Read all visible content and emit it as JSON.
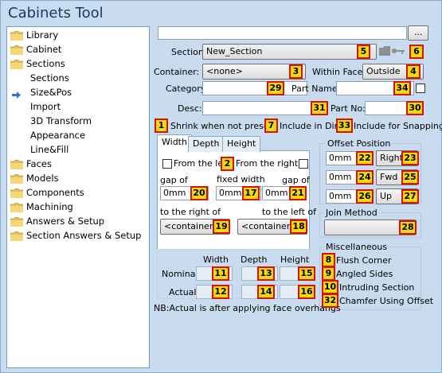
{
  "window": {
    "title": "Cabinets Tool"
  },
  "tree": {
    "items": [
      {
        "label": "Library",
        "level": 0,
        "folder": true
      },
      {
        "label": "Cabinet",
        "level": 0,
        "folder": true
      },
      {
        "label": "Sections",
        "level": 0,
        "folder": true
      },
      {
        "label": "Sections",
        "level": 1,
        "folder": false
      },
      {
        "label": "Size&Pos",
        "level": 1,
        "folder": false,
        "selected": true
      },
      {
        "label": "Import",
        "level": 1,
        "folder": false
      },
      {
        "label": "3D Transform",
        "level": 1,
        "folder": false
      },
      {
        "label": "Appearance",
        "level": 1,
        "folder": false
      },
      {
        "label": "Line&Fill",
        "level": 1,
        "folder": false
      },
      {
        "label": "Faces",
        "level": 0,
        "folder": true
      },
      {
        "label": "Models",
        "level": 0,
        "folder": true
      },
      {
        "label": "Components",
        "level": 0,
        "folder": true
      },
      {
        "label": "Machining",
        "level": 0,
        "folder": true
      },
      {
        "label": "Answers & Setup",
        "level": 0,
        "folder": true
      },
      {
        "label": "Section Answers & Setup",
        "level": 0,
        "folder": true
      }
    ]
  },
  "top": {
    "path_value": "",
    "browse_label": "..."
  },
  "section": {
    "label": "Section:",
    "value": "New_Section",
    "badge": "5",
    "badge2": "6"
  },
  "container": {
    "label": "Container:",
    "value": "<none>",
    "badge": "3"
  },
  "within_face": {
    "label": "Within Face:",
    "value": "Outside",
    "badge": "4"
  },
  "category": {
    "label": "Category:",
    "value": "",
    "badge": "29"
  },
  "part_name": {
    "label": "Part Name:",
    "value": "",
    "badge": "34"
  },
  "desc": {
    "label": "Desc:",
    "value": "",
    "badge": "31"
  },
  "part_no": {
    "label": "Part No:",
    "value": "",
    "badge": "30"
  },
  "flags": {
    "shrink": {
      "badge": "1",
      "label": "Shrink when not present"
    },
    "include_dims": {
      "badge": "7",
      "label": "Include in Dims"
    },
    "include_snap": {
      "badge": "33",
      "label": "Include for Snapping"
    }
  },
  "tabs": {
    "width": "Width",
    "depth": "Depth",
    "height": "Height"
  },
  "width_panel": {
    "from_left": "From the left",
    "from_left_badge": "2",
    "from_right": "From the right",
    "gap_of_left": "gap of",
    "gap_of_right": "gap of",
    "fixed_width": "fixed width",
    "left_gap_value": "0mm",
    "left_gap_badge": "20",
    "fixed_value": "0mm",
    "fixed_badge": "17",
    "right_gap_value": "0mm",
    "right_gap_badge": "21",
    "right_of": "to the right of",
    "left_of": "to the left of",
    "right_of_btn": "<container>",
    "right_of_badge": "19",
    "left_of_btn": "<container>",
    "left_of_badge": "18"
  },
  "offset": {
    "title": "Offset Position",
    "rows": [
      {
        "value": "0mm",
        "badge": "22",
        "button": "Right",
        "button_badge": "23"
      },
      {
        "value": "0mm",
        "badge": "24",
        "button": "Fwd",
        "button_badge": "25"
      },
      {
        "value": "0mm",
        "badge": "26",
        "button": "Up",
        "button_badge": "27"
      }
    ]
  },
  "join": {
    "title": "Join Method",
    "badge": "28"
  },
  "misc": {
    "title": "Miscellaneous",
    "items": [
      {
        "badge": "8",
        "label": "Flush Corner"
      },
      {
        "badge": "9",
        "label": "Angled Sides"
      },
      {
        "badge": "10",
        "label": "Intruding Section"
      },
      {
        "badge": "32",
        "label": "Chamfer Using Offset"
      }
    ]
  },
  "dims": {
    "width": "Width",
    "depth": "Depth",
    "height": "Height",
    "nominal": "Nominal:",
    "actual": "Actual:",
    "nominal_badges": [
      "11",
      "13",
      "15"
    ],
    "actual_badges": [
      "12",
      "14",
      "16"
    ],
    "note": "NB:Actual is after applying face overhangs"
  }
}
